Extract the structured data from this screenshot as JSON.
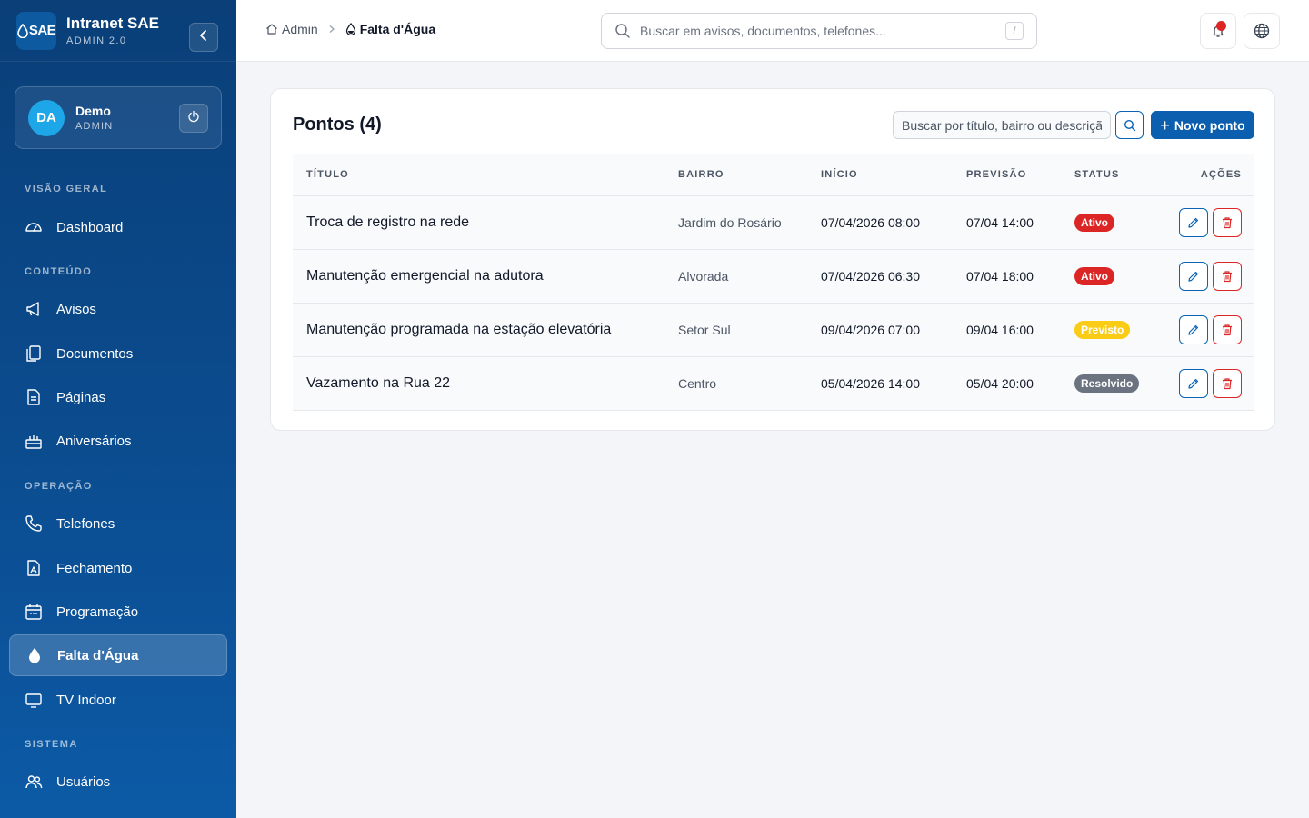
{
  "brand": {
    "logo_text": "SAE",
    "title": "Intranet SAE",
    "subtitle": "ADMIN 2.0"
  },
  "user": {
    "initials": "DA",
    "name": "Demo",
    "role": "ADMIN"
  },
  "sidebar": {
    "sections": [
      {
        "label": "VISÃO GERAL"
      },
      {
        "label": "CONTEÚDO"
      },
      {
        "label": "OPERAÇÃO"
      },
      {
        "label": "SISTEMA"
      }
    ],
    "items": [
      {
        "label": "Dashboard",
        "icon": "gauge-icon"
      },
      {
        "label": "Avisos",
        "icon": "megaphone-icon"
      },
      {
        "label": "Documentos",
        "icon": "documents-icon"
      },
      {
        "label": "Páginas",
        "icon": "page-icon"
      },
      {
        "label": "Aniversários",
        "icon": "cake-icon"
      },
      {
        "label": "Telefones",
        "icon": "phone-icon"
      },
      {
        "label": "Fechamento",
        "icon": "pdf-file-icon"
      },
      {
        "label": "Programação",
        "icon": "calendar-icon"
      },
      {
        "label": "Falta d'Água",
        "icon": "water-drop-icon",
        "active": true
      },
      {
        "label": "TV Indoor",
        "icon": "tv-icon"
      },
      {
        "label": "Usuários",
        "icon": "users-icon"
      }
    ]
  },
  "header": {
    "breadcrumb": {
      "root": "Admin",
      "current": "Falta d'Água"
    },
    "search": {
      "placeholder": "Buscar em avisos, documentos, telefones...",
      "shortcut": "/"
    }
  },
  "card": {
    "title": "Pontos (4)",
    "search_placeholder": "Buscar por título, bairro ou descrição",
    "new_button": "Novo ponto",
    "columns": [
      "TÍTULO",
      "BAIRRO",
      "INÍCIO",
      "PREVISÃO",
      "STATUS",
      "AÇÕES"
    ],
    "rows": [
      {
        "titulo": "Troca de registro na rede",
        "bairro": "Jardim do Rosário",
        "inicio": "07/04/2026 08:00",
        "previsao": "07/04 14:00",
        "status": "Ativo"
      },
      {
        "titulo": "Manutenção emergencial na adutora",
        "bairro": "Alvorada",
        "inicio": "07/04/2026 06:30",
        "previsao": "07/04 18:00",
        "status": "Ativo"
      },
      {
        "titulo": "Manutenção programada na estação elevatória",
        "bairro": "Setor Sul",
        "inicio": "09/04/2026 07:00",
        "previsao": "09/04 16:00",
        "status": "Previsto"
      },
      {
        "titulo": "Vazamento na Rua 22",
        "bairro": "Centro",
        "inicio": "05/04/2026 14:00",
        "previsao": "05/04 20:00",
        "status": "Resolvido"
      }
    ]
  },
  "colors": {
    "sidebar_top": "#0a3f78",
    "sidebar_bottom": "#0c5aa6",
    "primary": "#0b5fae",
    "status_ativo": "#dc2626",
    "status_previsto": "#facc15",
    "status_resolvido": "#6b7280"
  }
}
